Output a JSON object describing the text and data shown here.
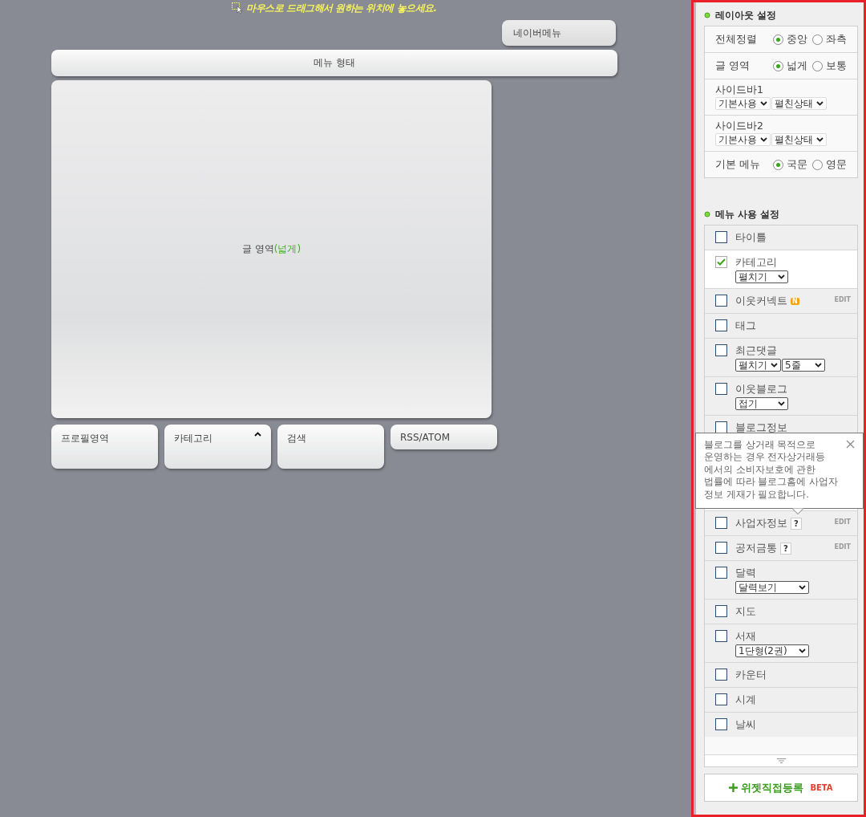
{
  "canvas": {
    "hint": "마우스로 드래그해서 원하는 위치에 놓으세요.",
    "naver_menu": "네이버메뉴",
    "menu_bar": "메뉴 형태",
    "content_area": {
      "label": "글 영역",
      "note": "(넓게)"
    },
    "widgets": [
      {
        "label": "프로필영역",
        "kind": "tall"
      },
      {
        "label": "카테고리",
        "kind": "toggle"
      },
      {
        "label": "검색",
        "kind": "tall"
      },
      {
        "label": "RSS/ATOM",
        "kind": "short"
      }
    ]
  },
  "layout": {
    "title": "레이아웃 설정",
    "rows": [
      {
        "kind": "radio",
        "label": "전체정렬",
        "options": [
          {
            "label": "중앙",
            "selected": true
          },
          {
            "label": "좌측",
            "selected": false
          }
        ]
      },
      {
        "kind": "radio",
        "label": "글 영역",
        "options": [
          {
            "label": "넓게",
            "selected": true
          },
          {
            "label": "보통",
            "selected": false
          }
        ]
      },
      {
        "kind": "selects",
        "label": "사이드바1",
        "selects": [
          "기본사용",
          "펼친상태"
        ]
      },
      {
        "kind": "selects",
        "label": "사이드바2",
        "selects": [
          "기본사용",
          "펼친상태"
        ]
      },
      {
        "kind": "radio",
        "label": "기본 메뉴",
        "options": [
          {
            "label": "국문",
            "selected": true
          },
          {
            "label": "영문",
            "selected": false
          }
        ]
      }
    ]
  },
  "menu": {
    "title": "메뉴 사용 설정",
    "items": [
      {
        "label": "타이틀",
        "checked": false
      },
      {
        "label": "카테고리",
        "checked": true,
        "selects": [
          "펼치기"
        ]
      },
      {
        "label": "이웃커넥트",
        "checked": false,
        "badge": "N",
        "edit": "EDIT"
      },
      {
        "label": "태그",
        "checked": false
      },
      {
        "label": "최근댓글",
        "checked": false,
        "selects": [
          "펼치기",
          "5줄"
        ]
      },
      {
        "label": "이웃블로그",
        "checked": false,
        "selects": [
          "접기"
        ]
      },
      {
        "label": "블로그정보",
        "checked": false,
        "covered": true
      },
      {
        "label": "사업자정보",
        "checked": false,
        "help": "?",
        "edit": "EDIT",
        "tooltip": "블로그를 상거래 목적으로\n운영하는 경우 전자상거래등\n에서의 소비자보호에 관한\n법률에 따라 블로그홈에 사업자\n정보 게재가 필요합니다."
      },
      {
        "label": "공저금통",
        "checked": false,
        "help": "?",
        "edit": "EDIT"
      },
      {
        "label": "달력",
        "checked": false,
        "selects": [
          "달력보기"
        ]
      },
      {
        "label": "지도",
        "checked": false
      },
      {
        "label": "서재",
        "checked": false,
        "selects": [
          "1단형(2권)"
        ]
      },
      {
        "label": "카운터",
        "checked": false
      },
      {
        "label": "시계",
        "checked": false
      },
      {
        "label": "날씨",
        "checked": false
      }
    ]
  },
  "add_button": {
    "label": "위젯직접등록",
    "badge": "BETA"
  }
}
